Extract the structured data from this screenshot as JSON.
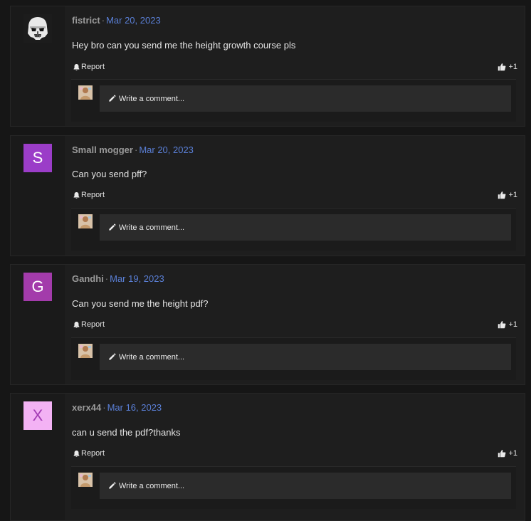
{
  "posts": [
    {
      "author": "fistrict",
      "separator": "·",
      "date": "Mar 20, 2023",
      "avatar": {
        "type": "image",
        "icon": "stormtrooper-avatar"
      },
      "message": "Hey bro can you send me the height growth course pls",
      "report_label": "Report",
      "like_label": "+1",
      "comment_placeholder": "Write a comment..."
    },
    {
      "author": "Small mogger",
      "separator": "·",
      "date": "Mar 20, 2023",
      "avatar": {
        "type": "letter",
        "letter": "S",
        "color": "#9b3dc8"
      },
      "message": "Can you send pff?",
      "report_label": "Report",
      "like_label": "+1",
      "comment_placeholder": "Write a comment..."
    },
    {
      "author": "Gandhi",
      "separator": "·",
      "date": "Mar 19, 2023",
      "avatar": {
        "type": "letter",
        "letter": "G",
        "color": "#a33bab"
      },
      "message": "Can you send me the height pdf?",
      "report_label": "Report",
      "like_label": "+1",
      "comment_placeholder": "Write a comment..."
    },
    {
      "author": "xerx44",
      "separator": "·",
      "date": "Mar 16, 2023",
      "avatar": {
        "type": "letter",
        "letter": "X",
        "color": "#f3b2f4"
      },
      "message": "can u send the pdf?thanks",
      "report_label": "Report",
      "like_label": "+1",
      "comment_placeholder": "Write a comment..."
    }
  ],
  "colors": {
    "date_link": "#5a7fd6",
    "author": "#9a9a9a",
    "background": "#161616",
    "card": "#1e1e1e",
    "input": "#2b2b2b"
  }
}
